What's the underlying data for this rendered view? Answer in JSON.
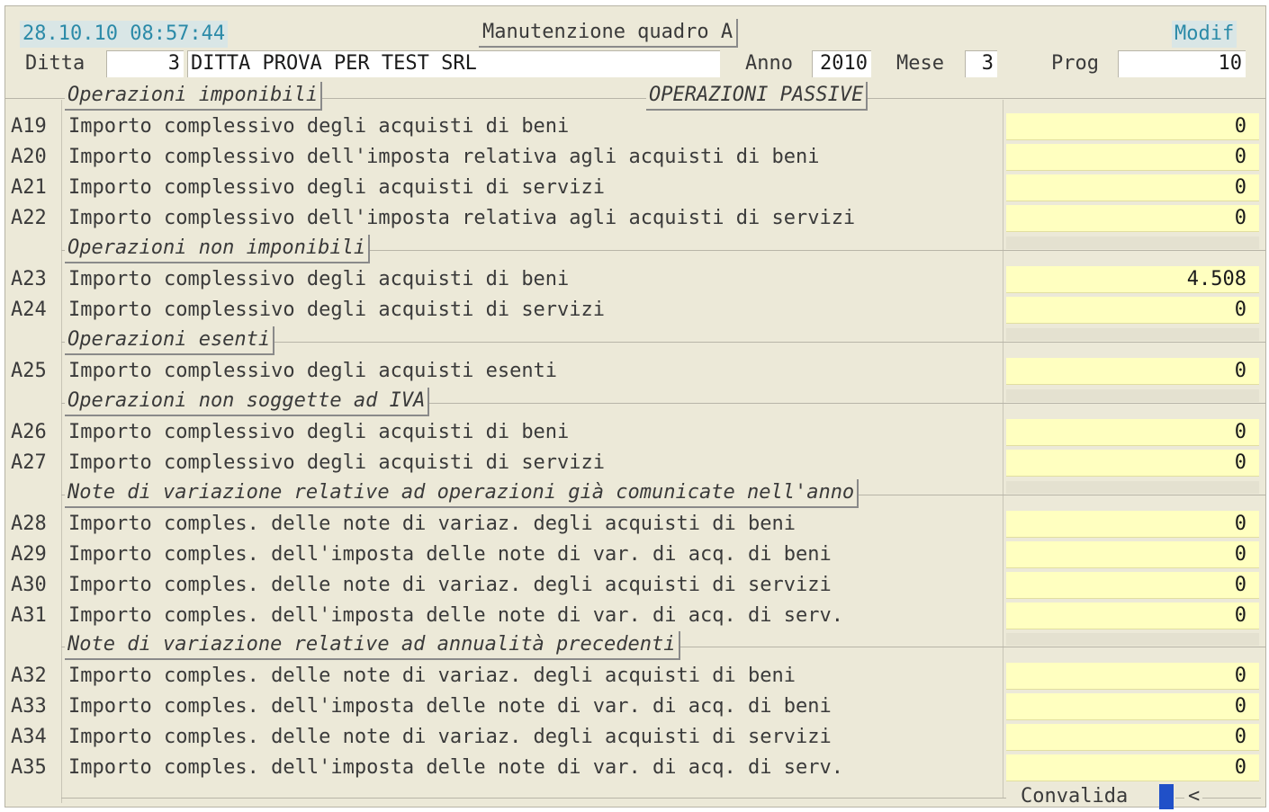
{
  "header": {
    "datetime": "28.10.10 08:57:44",
    "title": "Manutenzione quadro A",
    "mode": "Modif",
    "ditta_label": "Ditta",
    "ditta_code": "3",
    "ditta_name": "DITTA PROVA PER TEST SRL",
    "anno_label": "Anno",
    "anno_value": "2010",
    "mese_label": "Mese",
    "mese_value": "3",
    "prog_label": "Prog",
    "prog_value": "10"
  },
  "section_title": "OPERAZIONI PASSIVE",
  "groups": [
    {
      "label": "Operazioni imponibili"
    },
    {
      "label": "Operazioni non imponibili"
    },
    {
      "label": "Operazioni esenti"
    },
    {
      "label": "Operazioni non soggette ad IVA"
    },
    {
      "label": "Note di variazione relative ad operazioni già comunicate nell'anno"
    },
    {
      "label": "Note di variazione relative ad annualità precedenti"
    }
  ],
  "rows": [
    {
      "code": "A19",
      "desc": "Importo complessivo degli acquisti di beni",
      "value": "0"
    },
    {
      "code": "A20",
      "desc": "Importo complessivo dell'imposta relativa agli acquisti di beni",
      "value": "0"
    },
    {
      "code": "A21",
      "desc": "Importo complessivo degli acquisti di servizi",
      "value": "0"
    },
    {
      "code": "A22",
      "desc": "Importo complessivo dell'imposta relativa agli acquisti di servizi",
      "value": "0"
    },
    {
      "code": "A23",
      "desc": "Importo complessivo degli acquisti di beni",
      "value": "4.508"
    },
    {
      "code": "A24",
      "desc": "Importo complessivo degli acquisti di servizi",
      "value": "0"
    },
    {
      "code": "A25",
      "desc": "Importo complessivo degli acquisti esenti",
      "value": "0"
    },
    {
      "code": "A26",
      "desc": "Importo complessivo degli acquisti di beni",
      "value": "0"
    },
    {
      "code": "A27",
      "desc": "Importo complessivo degli acquisti di servizi",
      "value": "0"
    },
    {
      "code": "A28",
      "desc": "Importo comples. delle note di variaz. degli acquisti di beni",
      "value": "0"
    },
    {
      "code": "A29",
      "desc": "Importo comples. dell'imposta delle note di var. di acq. di beni",
      "value": "0"
    },
    {
      "code": "A30",
      "desc": "Importo comples. delle note di variaz. degli acquisti di servizi",
      "value": "0"
    },
    {
      "code": "A31",
      "desc": "Importo comples. dell'imposta delle note di var. di acq. di serv.",
      "value": "0"
    },
    {
      "code": "A32",
      "desc": "Importo comples. delle note di variaz. degli acquisti di beni",
      "value": "0"
    },
    {
      "code": "A33",
      "desc": "Importo comples. dell'imposta delle note di var. di acq. di beni",
      "value": "0"
    },
    {
      "code": "A34",
      "desc": "Importo comples. delle note di variaz. degli acquisti di servizi",
      "value": "0"
    },
    {
      "code": "A35",
      "desc": "Importo comples. dell'imposta delle note di var. di acq. di serv.",
      "value": "0"
    }
  ],
  "footer": {
    "convalida_label": "Convalida",
    "arrow": "<"
  },
  "colors": {
    "background": "#ece9d8",
    "amount_field": "#ffffc0",
    "cursor": "#2050c8",
    "header_accent": "#2b8aa8"
  }
}
